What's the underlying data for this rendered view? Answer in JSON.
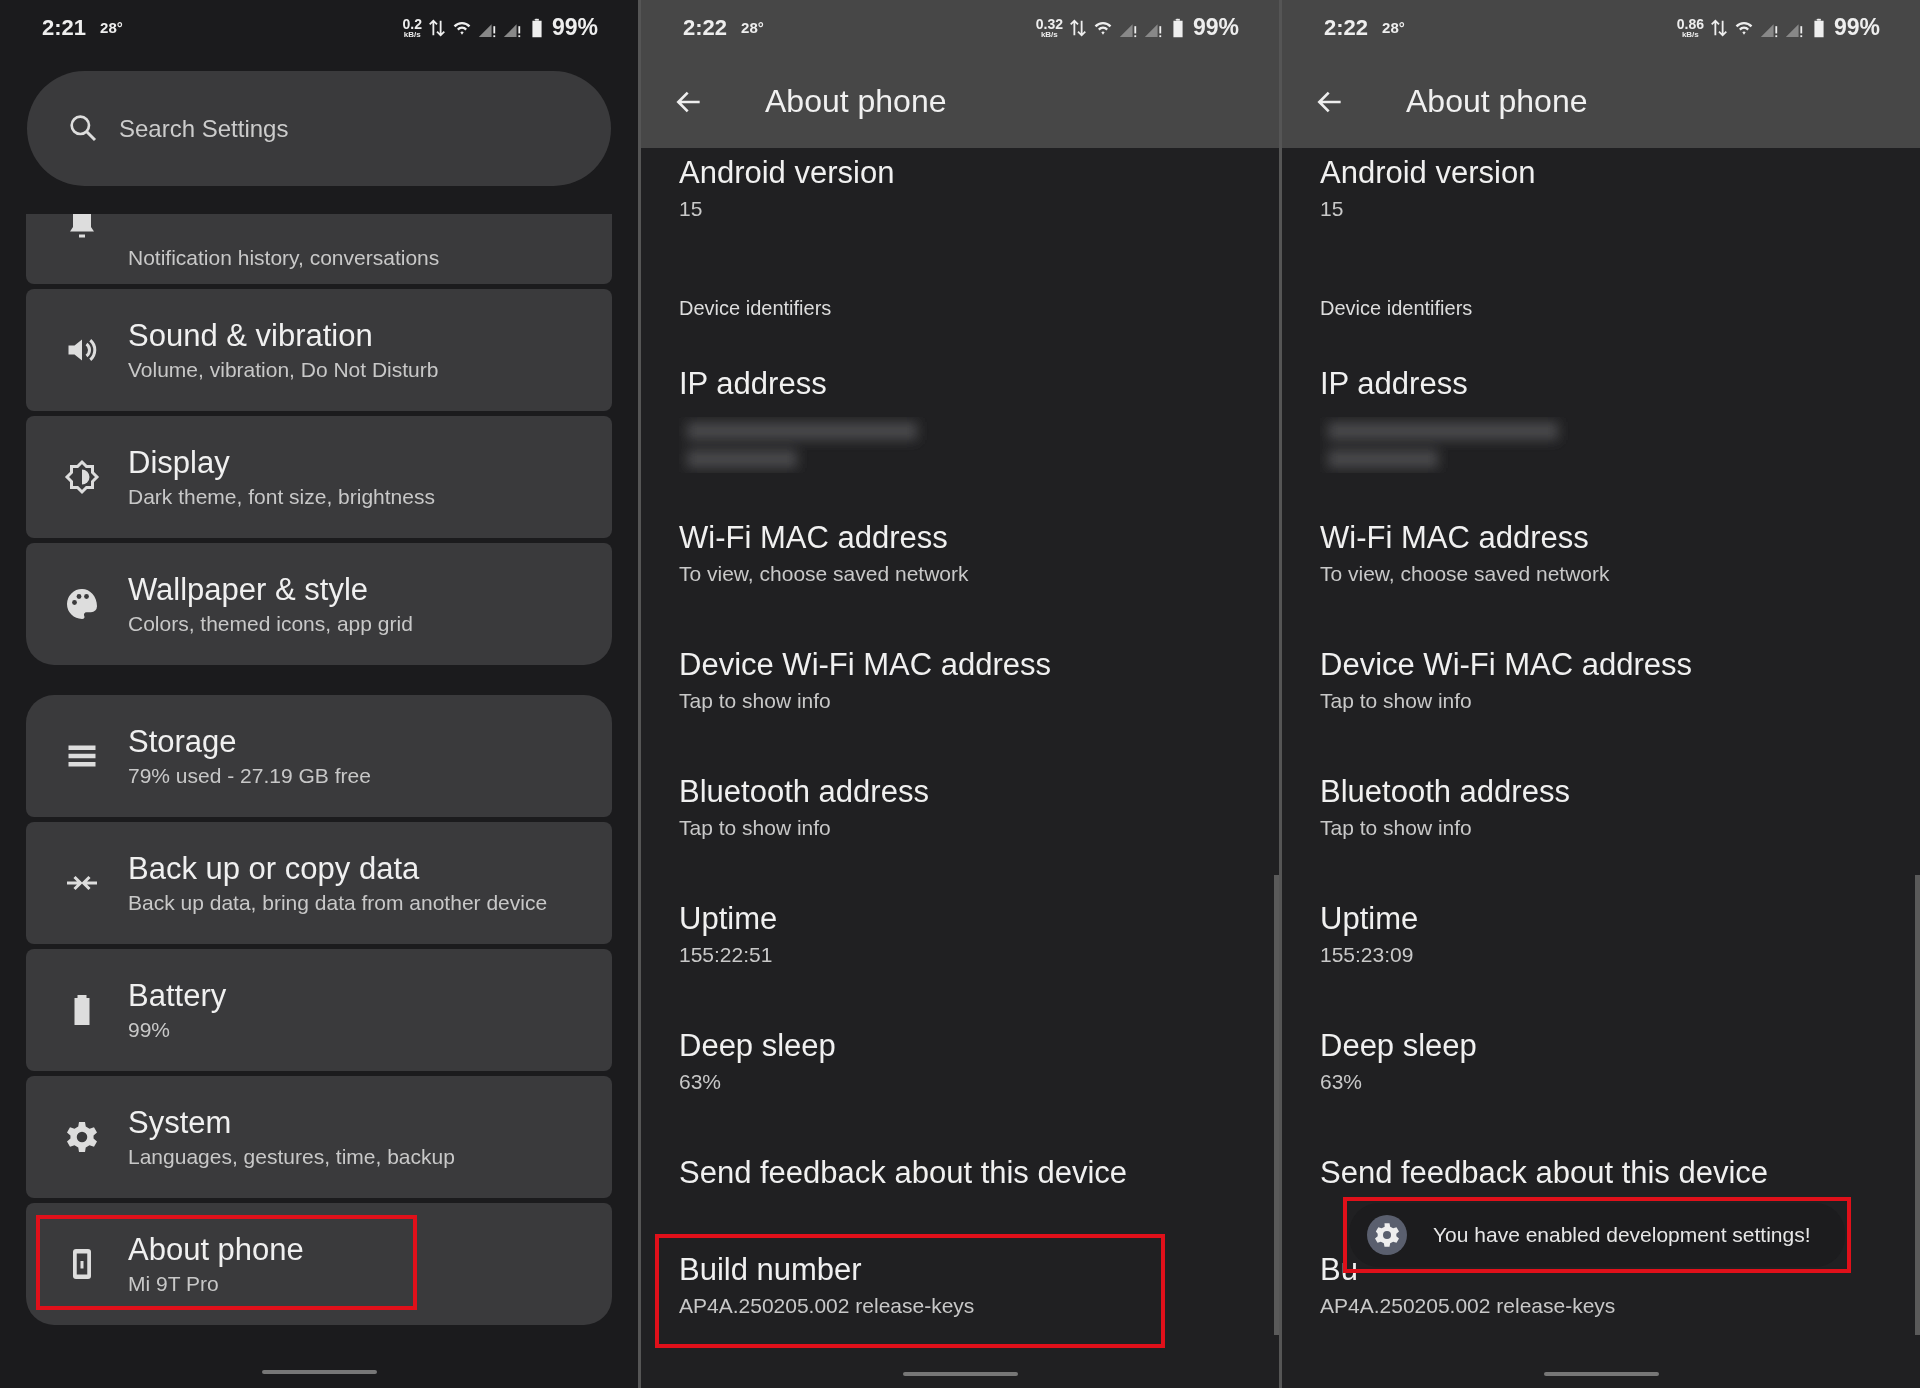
{
  "panels": [
    {
      "kind": "settings",
      "status_bar": {
        "time": "2:21",
        "temperature": "28°",
        "speed": "0.2",
        "speed_unit": "kB/s",
        "battery": "99%"
      },
      "search": {
        "placeholder": "Search Settings"
      },
      "groups": [
        {
          "cards": [
            {
              "subtitle": "Notification history, conversations",
              "highlighted": false
            },
            {
              "title": "Sound & vibration",
              "subtitle": "Volume, vibration, Do Not Disturb",
              "highlighted": false
            },
            {
              "title": "Display",
              "subtitle": "Dark theme, font size, brightness",
              "highlighted": false
            },
            {
              "title": "Wallpaper & style",
              "subtitle": "Colors, themed icons, app grid",
              "highlighted": false
            }
          ]
        },
        {
          "cards": [
            {
              "title": "Storage",
              "subtitle": "79% used - 27.19 GB free",
              "highlighted": false
            },
            {
              "title": "Back up or copy data",
              "subtitle": "Back up data, bring data from another device",
              "highlighted": false
            },
            {
              "title": "Battery",
              "subtitle": "99%",
              "highlighted": false
            },
            {
              "title": "System",
              "subtitle": "Languages, gestures, time, backup",
              "highlighted": false
            },
            {
              "title": "About phone",
              "subtitle": "Mi 9T Pro",
              "highlighted": true
            }
          ]
        }
      ]
    },
    {
      "kind": "about",
      "status_bar": {
        "time": "2:22",
        "temperature": "28°",
        "speed": "0.32",
        "speed_unit": "kB/s",
        "battery": "99%"
      },
      "app_bar": {
        "title": "About phone"
      },
      "rows": [
        {
          "kind": "entry",
          "title": "Android version",
          "subtitle": "15",
          "highlighted": false
        },
        {
          "kind": "header",
          "title": "Device identifiers"
        },
        {
          "kind": "hidden",
          "title": "IP address",
          "highlighted": false
        },
        {
          "kind": "entry",
          "title": "Wi-Fi MAC address",
          "subtitle": "To view, choose saved network",
          "highlighted": false
        },
        {
          "kind": "entry",
          "title": "Device Wi-Fi MAC address",
          "subtitle": "Tap to show info",
          "highlighted": false
        },
        {
          "kind": "entry",
          "title": "Bluetooth address",
          "subtitle": "Tap to show info",
          "highlighted": false
        },
        {
          "kind": "entry",
          "title": "Uptime",
          "subtitle": "155:22:51",
          "highlighted": false
        },
        {
          "kind": "entry",
          "title": "Deep sleep",
          "subtitle": "63%",
          "highlighted": false
        },
        {
          "kind": "entry",
          "title": "Send feedback about this device",
          "highlighted": false
        },
        {
          "kind": "entry",
          "title": "Build number",
          "subtitle": "AP4A.250205.002 release-keys",
          "highlighted": true
        }
      ]
    },
    {
      "kind": "about",
      "status_bar": {
        "time": "2:22",
        "temperature": "28°",
        "speed": "0.86",
        "speed_unit": "kB/s",
        "battery": "99%"
      },
      "app_bar": {
        "title": "About phone"
      },
      "rows": [
        {
          "kind": "entry",
          "title": "Android version",
          "subtitle": "15",
          "highlighted": false
        },
        {
          "kind": "header",
          "title": "Device identifiers"
        },
        {
          "kind": "hidden",
          "title": "IP address",
          "highlighted": false
        },
        {
          "kind": "entry",
          "title": "Wi-Fi MAC address",
          "subtitle": "To view, choose saved network",
          "highlighted": false
        },
        {
          "kind": "entry",
          "title": "Device Wi-Fi MAC address",
          "subtitle": "Tap to show info",
          "highlighted": false
        },
        {
          "kind": "entry",
          "title": "Bluetooth address",
          "subtitle": "Tap to show info",
          "highlighted": false
        },
        {
          "kind": "entry",
          "title": "Uptime",
          "subtitle": "155:23:09",
          "highlighted": false
        },
        {
          "kind": "entry",
          "title": "Deep sleep",
          "subtitle": "63%",
          "highlighted": false
        },
        {
          "kind": "entry",
          "title": "Send feedback about this device",
          "highlighted": false
        },
        {
          "kind": "entry",
          "title": "Bu",
          "subtitle": "AP4A.250205.002 release-keys",
          "highlighted": false
        }
      ],
      "toast": {
        "text": "You have enabled development settings!",
        "highlighted": true
      }
    }
  ]
}
